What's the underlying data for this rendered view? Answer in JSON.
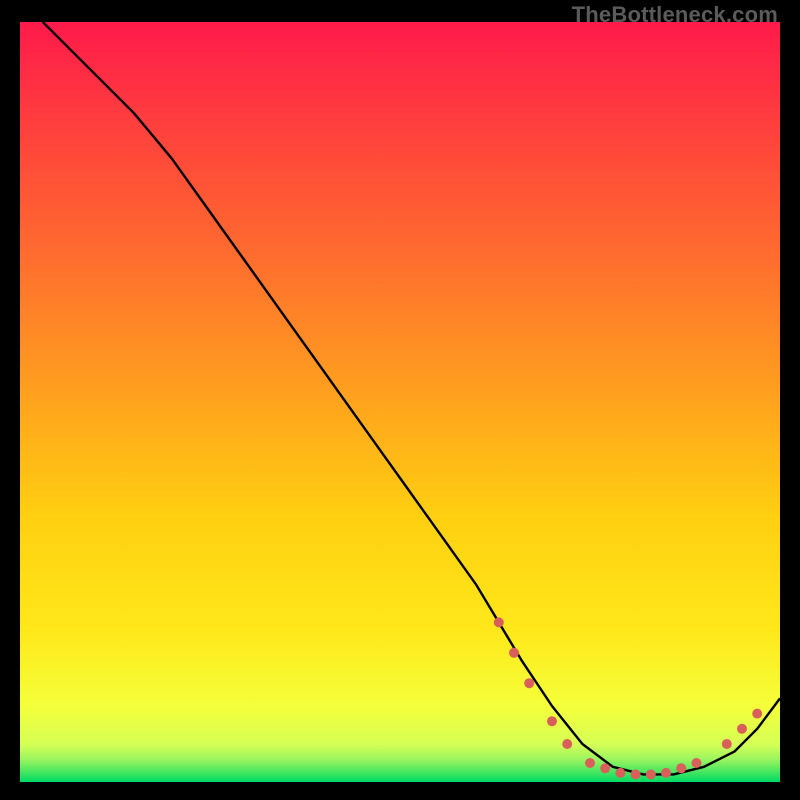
{
  "watermark": "TheBottleneck.com",
  "chart_data": {
    "type": "line",
    "title": "",
    "xlabel": "",
    "ylabel": "",
    "xlim": [
      0,
      100
    ],
    "ylim": [
      0,
      100
    ],
    "grid": false,
    "legend": false,
    "background_gradient": {
      "top_color": "#ff1a4b",
      "mid_color": "#ffd500",
      "bottom_band_color": "#00e060",
      "bottom_band_start_pct": 96
    },
    "series": [
      {
        "name": "bottleneck-curve",
        "color": "#000000",
        "x": [
          3,
          6,
          10,
          15,
          20,
          25,
          30,
          35,
          40,
          45,
          50,
          55,
          60,
          63,
          66,
          70,
          74,
          78,
          82,
          86,
          90,
          94,
          97,
          100
        ],
        "y": [
          100,
          97,
          93,
          88,
          82,
          75,
          68,
          61,
          54,
          47,
          40,
          33,
          26,
          21,
          16,
          10,
          5,
          2,
          1,
          1,
          2,
          4,
          7,
          11
        ]
      }
    ],
    "markers": {
      "name": "highlight-points",
      "color": "#d9605a",
      "radius": 5,
      "points": [
        {
          "x": 63,
          "y": 21
        },
        {
          "x": 65,
          "y": 17
        },
        {
          "x": 67,
          "y": 13
        },
        {
          "x": 70,
          "y": 8
        },
        {
          "x": 72,
          "y": 5
        },
        {
          "x": 75,
          "y": 2.5
        },
        {
          "x": 77,
          "y": 1.8
        },
        {
          "x": 79,
          "y": 1.2
        },
        {
          "x": 81,
          "y": 1
        },
        {
          "x": 83,
          "y": 1
        },
        {
          "x": 85,
          "y": 1.2
        },
        {
          "x": 87,
          "y": 1.8
        },
        {
          "x": 89,
          "y": 2.5
        },
        {
          "x": 93,
          "y": 5
        },
        {
          "x": 95,
          "y": 7
        },
        {
          "x": 97,
          "y": 9
        }
      ]
    }
  }
}
